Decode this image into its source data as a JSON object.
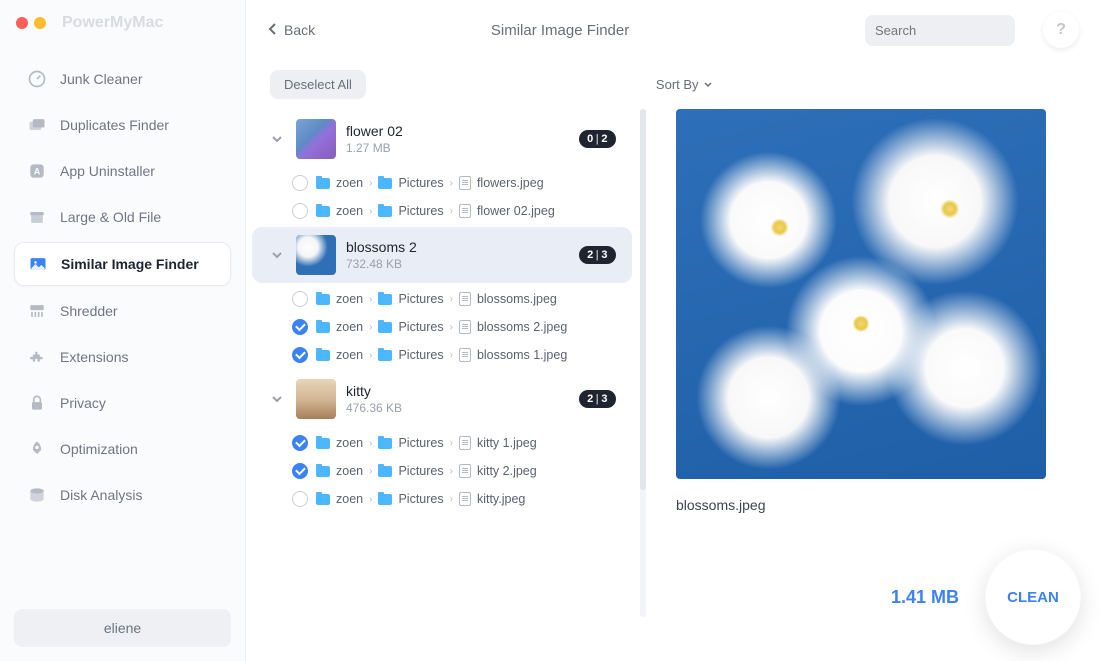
{
  "app_name": "PowerMyMac",
  "back_label": "Back",
  "page_title": "Similar Image Finder",
  "search_placeholder": "Search",
  "help_label": "?",
  "deselect_label": "Deselect All",
  "sort_label": "Sort By",
  "user": "eliene",
  "total_size": "1.41 MB",
  "clean_label": "CLEAN",
  "sidebar": {
    "items": [
      {
        "label": "Junk Cleaner"
      },
      {
        "label": "Duplicates Finder"
      },
      {
        "label": "App Uninstaller"
      },
      {
        "label": "Large & Old File"
      },
      {
        "label": "Similar Image Finder"
      },
      {
        "label": "Shredder"
      },
      {
        "label": "Extensions"
      },
      {
        "label": "Privacy"
      },
      {
        "label": "Optimization"
      },
      {
        "label": "Disk Analysis"
      }
    ]
  },
  "groups": [
    {
      "name": "flower 02",
      "size": "1.27 MB",
      "badge_sel": "0",
      "badge_tot": "2",
      "files": [
        {
          "checked": false,
          "path": [
            "zoen",
            "Pictures"
          ],
          "file": "flowers.jpeg"
        },
        {
          "checked": false,
          "path": [
            "zoen",
            "Pictures"
          ],
          "file": "flower 02.jpeg"
        }
      ]
    },
    {
      "name": "blossoms 2",
      "size": "732.48 KB",
      "badge_sel": "2",
      "badge_tot": "3",
      "files": [
        {
          "checked": false,
          "path": [
            "zoen",
            "Pictures"
          ],
          "file": "blossoms.jpeg"
        },
        {
          "checked": true,
          "path": [
            "zoen",
            "Pictures"
          ],
          "file": "blossoms 2.jpeg"
        },
        {
          "checked": true,
          "path": [
            "zoen",
            "Pictures"
          ],
          "file": "blossoms 1.jpeg"
        }
      ]
    },
    {
      "name": "kitty",
      "size": "476.36 KB",
      "badge_sel": "2",
      "badge_tot": "3",
      "files": [
        {
          "checked": true,
          "path": [
            "zoen",
            "Pictures"
          ],
          "file": "kitty 1.jpeg"
        },
        {
          "checked": true,
          "path": [
            "zoen",
            "Pictures"
          ],
          "file": "kitty 2.jpeg"
        },
        {
          "checked": false,
          "path": [
            "zoen",
            "Pictures"
          ],
          "file": "kitty.jpeg"
        }
      ]
    }
  ],
  "preview": {
    "filename": "blossoms.jpeg"
  }
}
